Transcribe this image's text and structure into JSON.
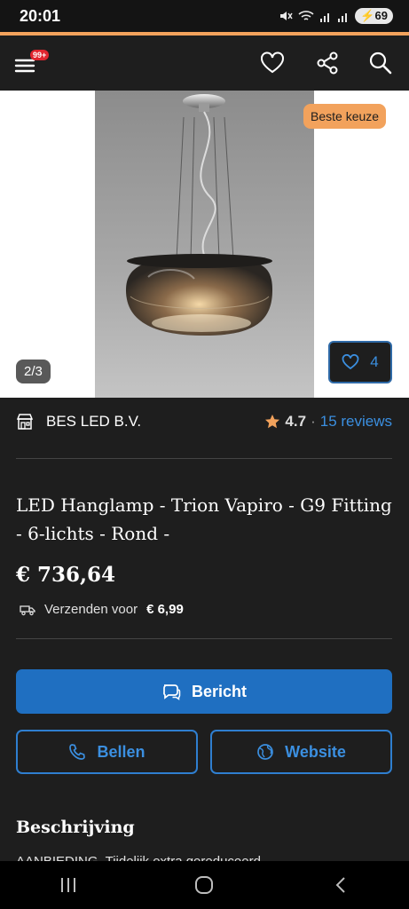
{
  "status_bar": {
    "time": "20:01",
    "battery": "69",
    "icons": [
      "mute-icon",
      "wifi-icon",
      "signal-icon",
      "signal-icon"
    ]
  },
  "header": {
    "menu_badge": "99+",
    "icons": [
      "menu-icon",
      "heart-icon",
      "share-icon",
      "search-icon"
    ]
  },
  "gallery": {
    "badge": "Beste keuze",
    "page_indicator": "2/3",
    "favorites_count": "4"
  },
  "seller": {
    "name": "BES LED B.V.",
    "rating": "4.7",
    "separator": "·",
    "reviews": "15 reviews"
  },
  "product": {
    "title": "LED Hanglamp - Trion Vapiro - G9 Fitting - 6-lichts - Rond -",
    "price": "€ 736,64",
    "shipping_label": "Verzenden voor",
    "shipping_price": "€ 6,99"
  },
  "actions": {
    "message": "Bericht",
    "call": "Bellen",
    "website": "Website"
  },
  "description": {
    "title": "Beschrijving",
    "snippet": "AANBIEDING. Tijdelijk extra gereduceerd"
  },
  "colors": {
    "accent": "#f2a25c",
    "primary": "#1f6fc1",
    "link": "#3b8fe0",
    "background": "#1e1e1e"
  }
}
